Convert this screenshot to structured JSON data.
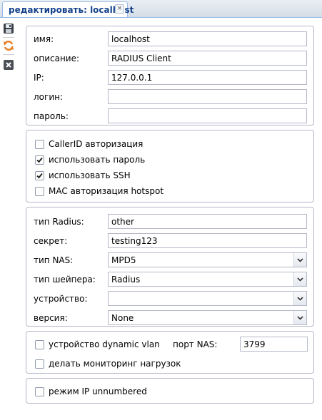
{
  "tab": {
    "title": "редактировать: localhost"
  },
  "toolbar": {
    "save": "save-icon",
    "refresh": "refresh-icon",
    "close": "close-icon"
  },
  "general": {
    "name_label": "имя:",
    "name_value": "localhost",
    "description_label": "описание:",
    "description_value": "RADIUS Client",
    "ip_label": "IP:",
    "ip_value": "127.0.0.1",
    "login_label": "логин:",
    "login_value": "",
    "password_label": "пароль:",
    "password_value": ""
  },
  "options": {
    "callerid": {
      "label": "CallerID авторизация",
      "checked": false
    },
    "use_password": {
      "label": "использовать пароль",
      "checked": true
    },
    "use_ssh": {
      "label": "использовать SSH",
      "checked": true
    },
    "mac_hotspot": {
      "label": "MAC авторизация hotspot",
      "checked": false
    }
  },
  "radius": {
    "type_label": "тип Radius:",
    "type_value": "other",
    "secret_label": "секрет:",
    "secret_value": "testing123",
    "nas_label": "тип NAS:",
    "nas_value": "MPD5",
    "shaper_label": "тип шейпера:",
    "shaper_value": "Radius",
    "device_label": "устройство:",
    "device_value": "",
    "version_label": "версия:",
    "version_value": "None"
  },
  "vlan": {
    "dynamic_vlan": {
      "label": "устройство dynamic vlan",
      "checked": false
    },
    "nas_port_label": "порт NAS:",
    "nas_port_value": "3799",
    "load_monitoring": {
      "label": "делать мониторинг нагрузок",
      "checked": false
    }
  },
  "unnumbered": {
    "label": "режим IP unnumbered",
    "checked": false
  },
  "colors": {
    "tab_text": "#15428b",
    "border": "#b5b8c8",
    "tab_border": "#99bbe8"
  }
}
